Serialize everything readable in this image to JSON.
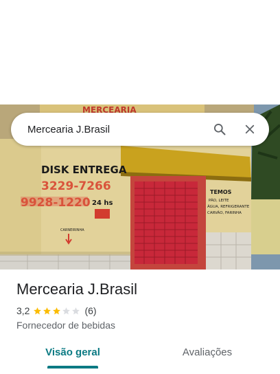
{
  "search": {
    "query": "Mercearia J.Brasil"
  },
  "icons": {
    "search": "search-icon",
    "close": "close-icon"
  },
  "photo_signage": {
    "delivery_label": "DISK ENTREGA",
    "phone_1": "3229-7266",
    "phone_2": "9928-1220",
    "hours": "24 hs",
    "small_sign": "CARNEIRINHA",
    "items_title": "TEMOS",
    "items": [
      "PÃO, LEITE",
      "ÁGUA, REFRIGERANTE",
      "CARVÃO, FARINHA"
    ]
  },
  "place": {
    "name": "Mercearia J.Brasil",
    "rating": "3,2",
    "rating_value": 3.2,
    "stars_max": 5,
    "review_count": "(6)",
    "category": "Fornecedor de bebidas"
  },
  "tabs": [
    {
      "label": "Visão geral",
      "active": true
    },
    {
      "label": "Avaliações",
      "active": false
    }
  ],
  "colors": {
    "accent": "#0b7a83",
    "star": "#fbbc04",
    "star_empty": "#dadce0",
    "wall": "#e2d29a",
    "shutter": "#c8283a",
    "awning": "#c9a21e",
    "sky": "#6b8aa3"
  }
}
